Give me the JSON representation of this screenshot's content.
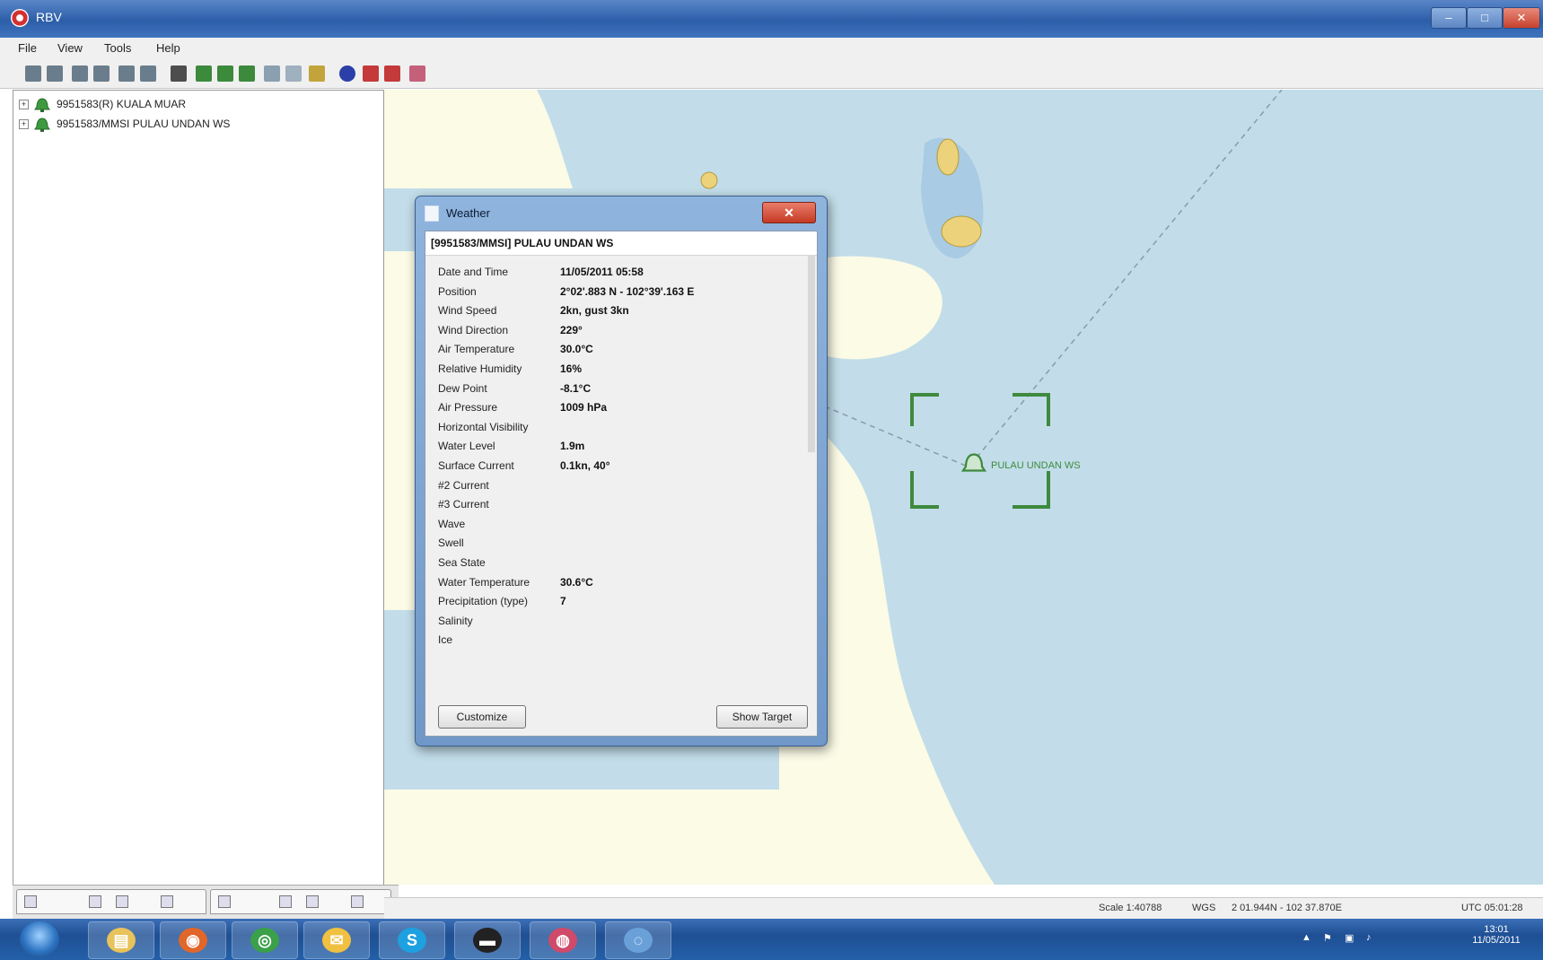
{
  "window": {
    "title": "RBV",
    "minimize_glyph": "–",
    "maximize_glyph": "□",
    "close_glyph": "✕"
  },
  "menu": [
    "File",
    "View",
    "Tools",
    "Help"
  ],
  "toolbar": {
    "buttons": [
      {
        "name": "zoom-in-icon",
        "color": "#6a7d8c"
      },
      {
        "name": "zoom-out-icon",
        "color": "#6a7d8c"
      },
      {
        "name": "pan-left-icon",
        "color": "#6a7d8c"
      },
      {
        "name": "pan-right-icon",
        "color": "#6a7d8c"
      },
      {
        "name": "pan-up-icon",
        "color": "#6a7d8c"
      },
      {
        "name": "pan-down-icon",
        "color": "#6a7d8c"
      },
      {
        "name": "tool-icon",
        "color": "#4d4d4d"
      },
      {
        "name": "route-icon",
        "color": "#3c8a3c"
      },
      {
        "name": "layer-icon",
        "color": "#3c8a3c"
      },
      {
        "name": "edit-icon",
        "color": "#3c8a3c"
      },
      {
        "name": "grid-icon",
        "color": "#8aa0b0"
      },
      {
        "name": "table-icon",
        "color": "#9fb0bf"
      },
      {
        "name": "chart-icon",
        "color": "#c2a43a"
      },
      {
        "name": "globe-icon",
        "color": "#2a3fa8"
      },
      {
        "name": "red-box-icon",
        "color": "#c43a3a"
      },
      {
        "name": "red-box-2-icon",
        "color": "#c43a3a"
      },
      {
        "name": "pink-box-icon",
        "color": "#c4607a"
      }
    ]
  },
  "tree": {
    "items": [
      {
        "expander": "+",
        "label": "9951583(R) KUALA MUAR"
      },
      {
        "expander": "+",
        "label": "9951583/MMSI PULAU UNDAN WS"
      }
    ]
  },
  "map": {
    "target_label": "PULAU UNDAN WS",
    "colors": {
      "sea": "#c2dde9",
      "land": "#fbfbe6",
      "shallow": "#a9cbe3",
      "island": "#ecd27a",
      "target": "#3e8a3e"
    }
  },
  "dialog": {
    "title": "Weather",
    "close_label": "✕",
    "station": "[9951583/MMSI] PULAU UNDAN WS",
    "fields": [
      {
        "label": "Date and Time",
        "value": "11/05/2011 05:58"
      },
      {
        "label": "Position",
        "value": "2°02'.883 N - 102°39'.163 E"
      },
      {
        "label": "Wind Speed",
        "value": "2kn, gust 3kn"
      },
      {
        "label": "Wind Direction",
        "value": "229°"
      },
      {
        "label": "Air Temperature",
        "value": "30.0°C"
      },
      {
        "label": "Relative Humidity",
        "value": "16%"
      },
      {
        "label": "Dew Point",
        "value": "-8.1°C"
      },
      {
        "label": "Air Pressure",
        "value": "1009 hPa"
      },
      {
        "label": "Horizontal Visibility",
        "value": ""
      },
      {
        "label": "Water Level",
        "value": "1.9m"
      },
      {
        "label": "Surface Current",
        "value": "0.1kn, 40°"
      },
      {
        "label": "#2 Current",
        "value": ""
      },
      {
        "label": "#3 Current",
        "value": ""
      },
      {
        "label": "Wave",
        "value": ""
      },
      {
        "label": "Swell",
        "value": ""
      },
      {
        "label": "Sea State",
        "value": ""
      },
      {
        "label": "Water Temperature",
        "value": "30.6°C"
      },
      {
        "label": "Precipitation (type)",
        "value": "7"
      },
      {
        "label": "Salinity",
        "value": ""
      },
      {
        "label": "Ice",
        "value": ""
      }
    ],
    "buttons": {
      "left": "Customize",
      "right": "Show Target"
    }
  },
  "status": {
    "scale": "Scale 1:40788",
    "datum": "WGS",
    "position": "2 01.944N - 102 37.870E",
    "time": "UTC 05:01:28"
  },
  "taskbar": {
    "apps": [
      {
        "name": "explorer-icon",
        "glyph": "▤",
        "color": "#e8c25a"
      },
      {
        "name": "firefox-icon",
        "glyph": "◉",
        "color": "#e0662a"
      },
      {
        "name": "chrome-icon",
        "glyph": "◎",
        "color": "#3aa04a"
      },
      {
        "name": "mail-icon",
        "glyph": "✉",
        "color": "#f0c040"
      },
      {
        "name": "skype-icon",
        "glyph": "S",
        "color": "#1da1e0"
      },
      {
        "name": "terminal-icon",
        "glyph": "▬",
        "color": "#222222"
      },
      {
        "name": "app-icon-red",
        "glyph": "◍",
        "color": "#d04a6a"
      },
      {
        "name": "app-icon-globe",
        "glyph": "◌",
        "color": "#6aa0d8"
      }
    ],
    "clock_time": "13:01",
    "clock_date": "11/05/2011"
  }
}
